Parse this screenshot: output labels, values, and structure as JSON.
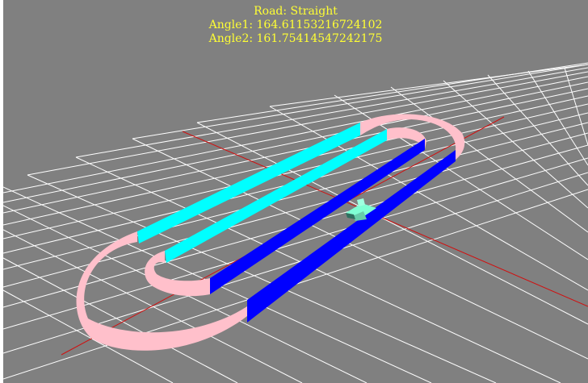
{
  "hud": {
    "road_label": "Road: Straight",
    "angle1_label": "Angle1: 164.61153216724102",
    "angle2_label": "Angle2: 161.75414547242175"
  },
  "colors": {
    "background": "#808080",
    "grid": "#ffffff",
    "axis": "#d01010",
    "text": "#ffff33",
    "track_curve": "#ffc0cb",
    "track_straight_a": "#00ffff",
    "track_straight_b": "#0000ff",
    "car": "#7fffd4"
  }
}
